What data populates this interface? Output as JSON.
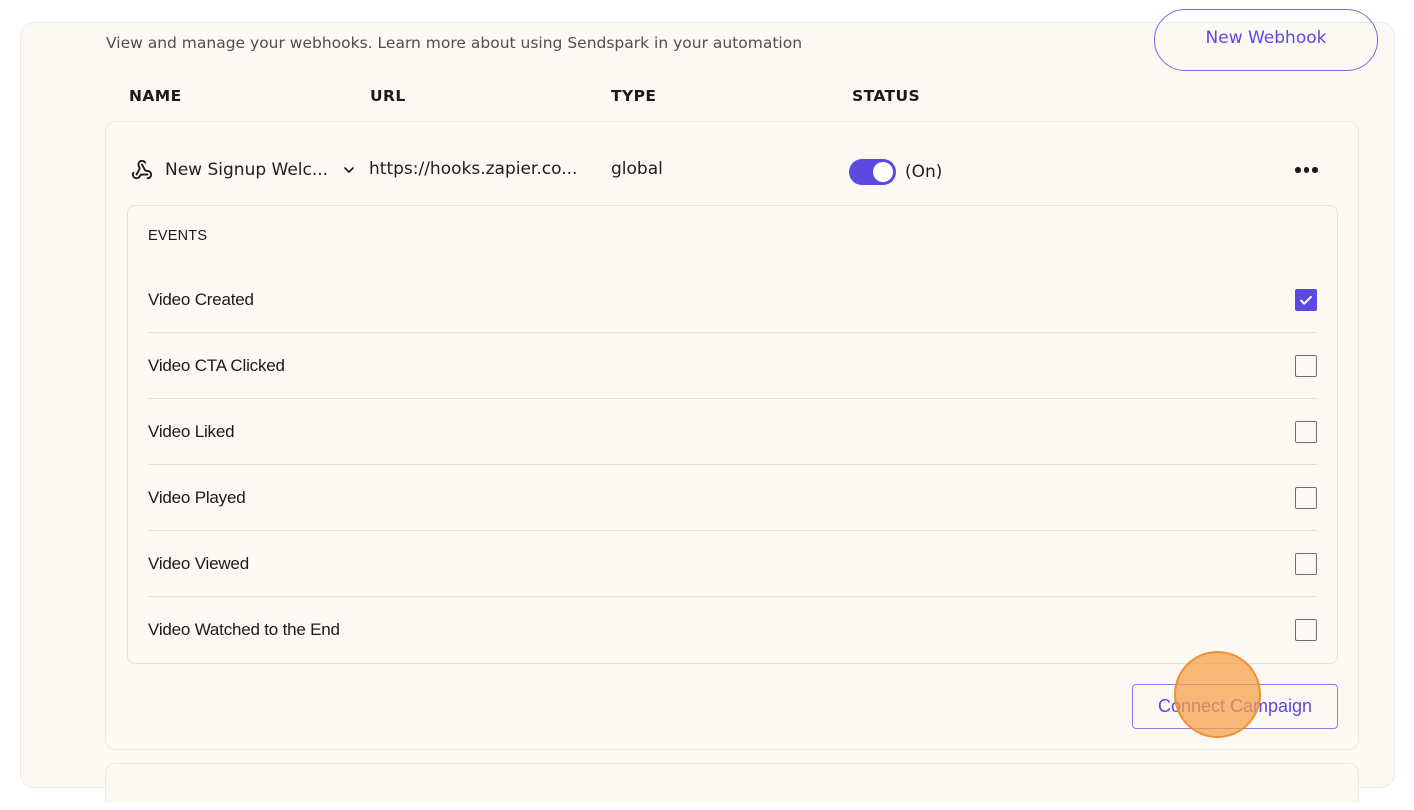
{
  "header": {
    "new_webhook_label": "New Webhook",
    "subtitle": "View and manage your webhooks. Learn more about using Sendspark in your automation"
  },
  "columns": {
    "name": "NAME",
    "url": "URL",
    "type": "TYPE",
    "status": "STATUS"
  },
  "webhook": {
    "name": "New Signup Welc...",
    "url": "https://hooks.zapier.co...",
    "type": "global",
    "status_label": "(On)",
    "enabled": true,
    "icons": {
      "webhook": "webhook-icon",
      "expand": "chevron-down-icon",
      "more": "more-horizontal-icon"
    }
  },
  "events": {
    "heading": "EVENTS",
    "items": [
      {
        "label": "Video Created",
        "checked": true
      },
      {
        "label": "Video CTA Clicked",
        "checked": false
      },
      {
        "label": "Video Liked",
        "checked": false
      },
      {
        "label": "Video Played",
        "checked": false
      },
      {
        "label": "Video Viewed",
        "checked": false
      },
      {
        "label": "Video Watched to the End",
        "checked": false
      }
    ]
  },
  "actions": {
    "connect_campaign_label": "Connect Campaign"
  },
  "colors": {
    "accent": "#5b49e0",
    "background": "#fcf8f3",
    "click_indicator": "#f5a046"
  }
}
